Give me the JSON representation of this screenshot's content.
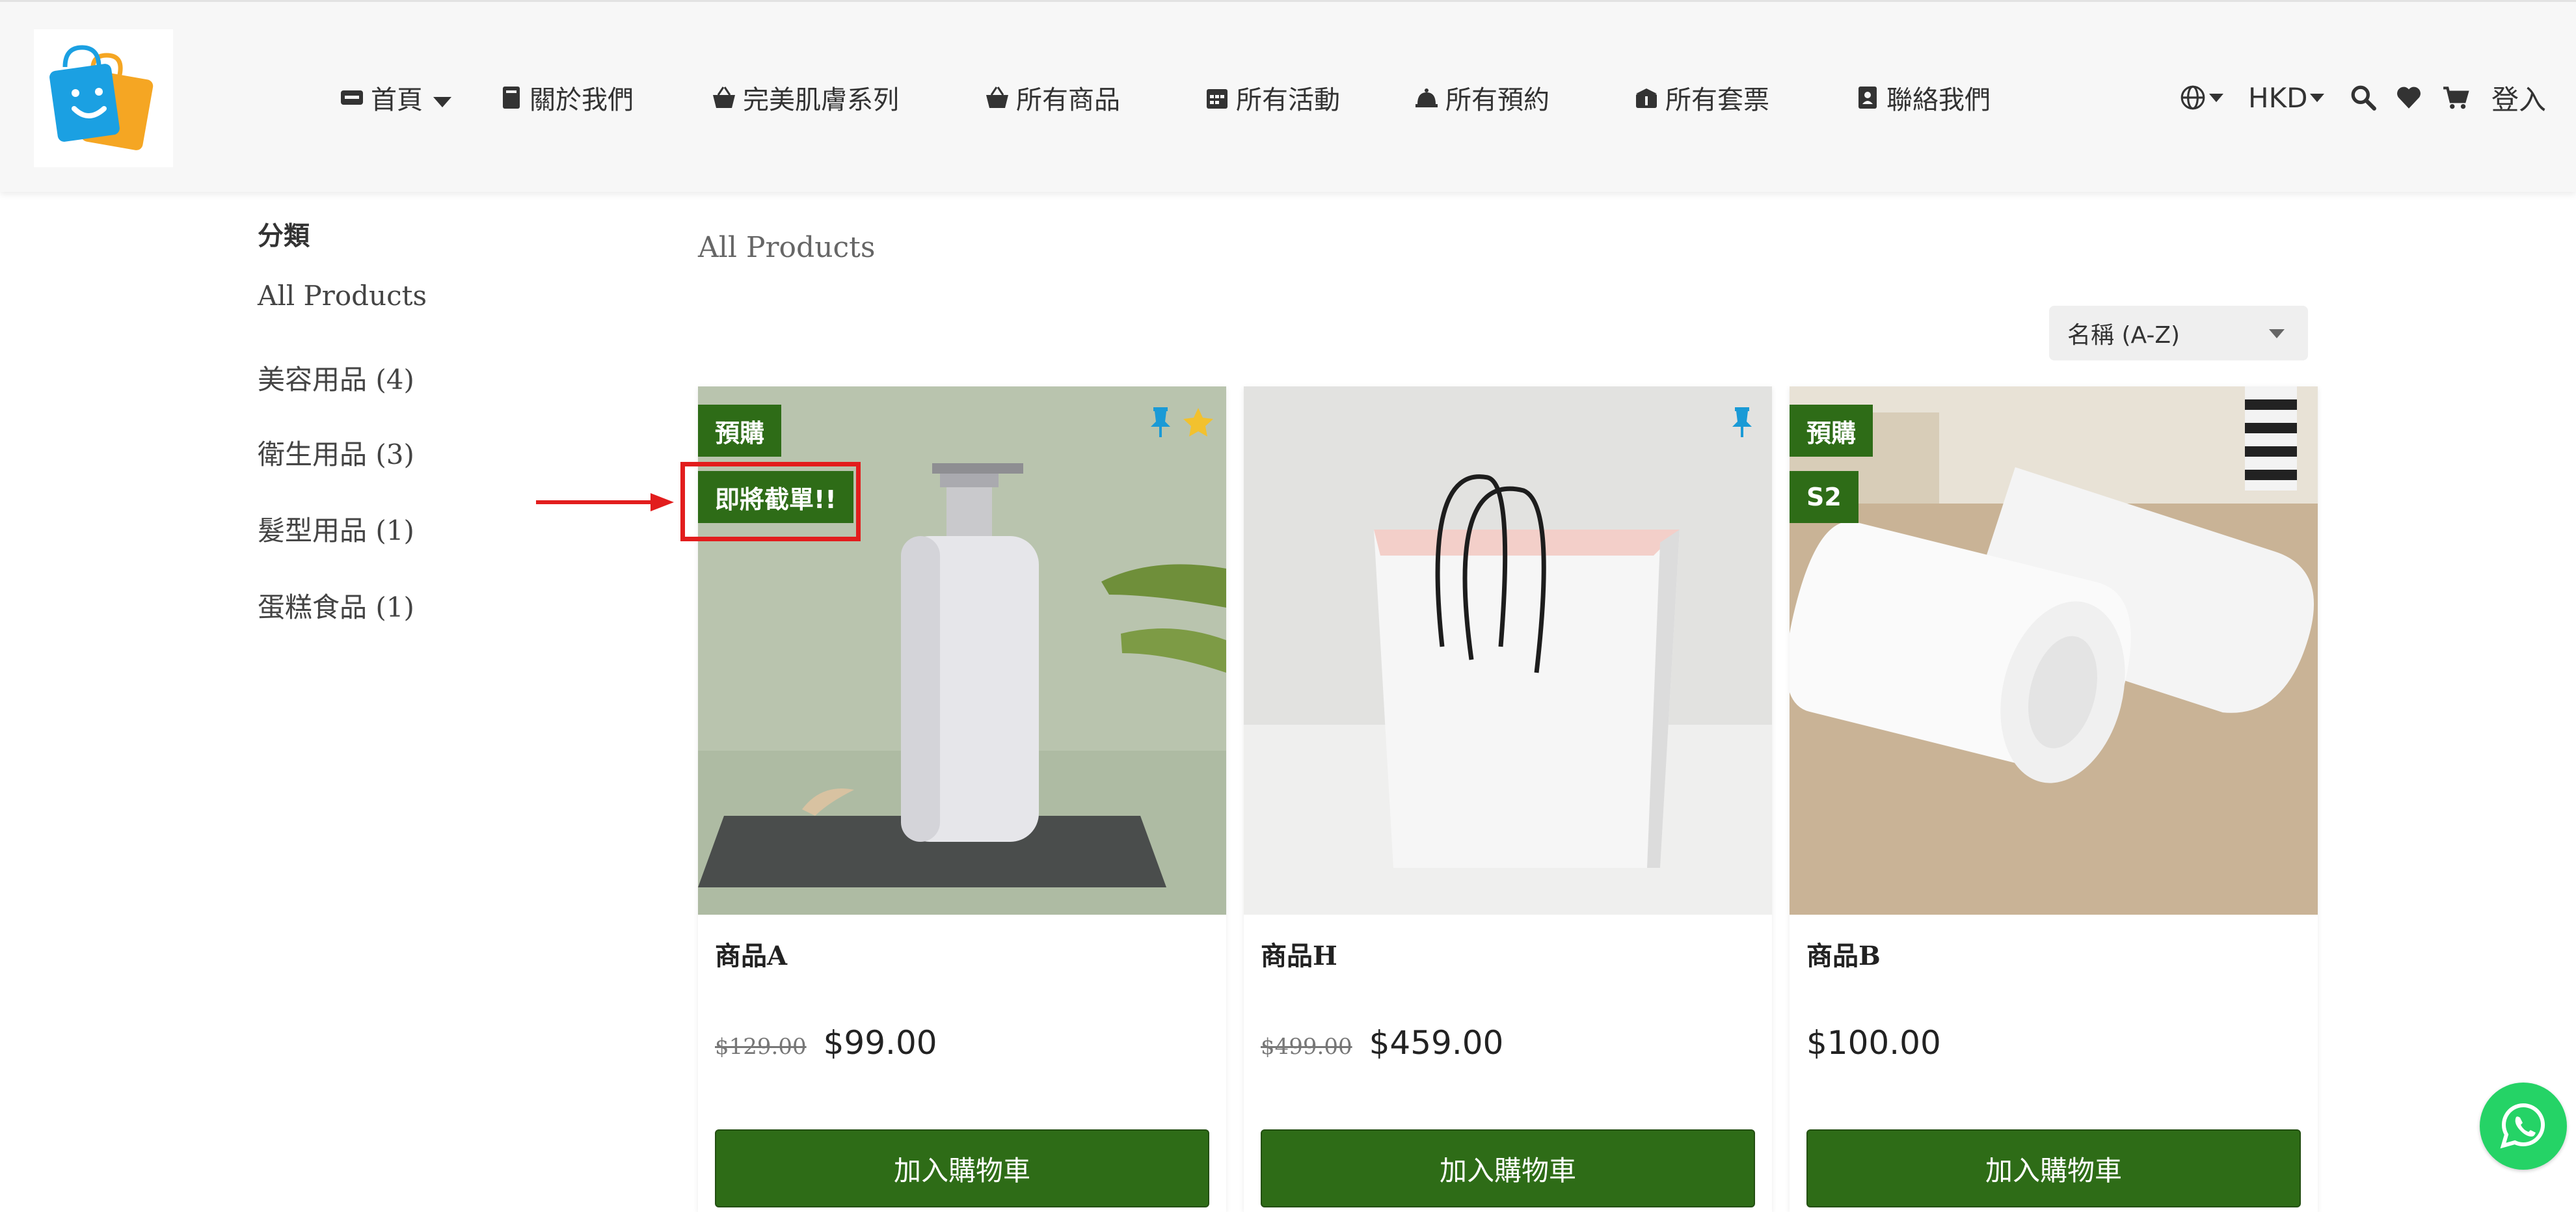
{
  "header": {
    "nav": [
      {
        "label": "首頁",
        "icon": "home-icon"
      },
      {
        "label": "關於我們",
        "icon": "book-icon"
      },
      {
        "label": "完美肌膚系列",
        "icon": "basket-icon"
      },
      {
        "label": "所有商品",
        "icon": "basket-icon"
      },
      {
        "label": "所有活動",
        "icon": "calendar-icon"
      },
      {
        "label": "所有預約",
        "icon": "bell-icon"
      },
      {
        "label": "所有套票",
        "icon": "ticket-icon"
      },
      {
        "label": "聯絡我們",
        "icon": "contact-book-icon"
      }
    ],
    "currency": "HKD",
    "login": "登入"
  },
  "sidebar": {
    "title": "分類",
    "items": [
      {
        "label": "All Products"
      },
      {
        "label": "美容用品 (4)"
      },
      {
        "label": "衛生用品 (3)"
      },
      {
        "label": "髮型用品 (1)"
      },
      {
        "label": "蛋糕食品 (1)"
      }
    ]
  },
  "main": {
    "breadcrumb": "All Products",
    "sort_value": "名稱 (A-Z)",
    "add_to_cart": "加入購物車",
    "products": [
      {
        "name": "商品A",
        "old_price": "$129.00",
        "price": "$99.00",
        "tags": [
          "預購",
          "即將截單!!"
        ],
        "pinned": true,
        "starred": true
      },
      {
        "name": "商品H",
        "old_price": "$499.00",
        "price": "$459.00",
        "tags": [],
        "pinned": true,
        "starred": false
      },
      {
        "name": "商品B",
        "old_price": "",
        "price": "$100.00",
        "tags": [
          "預購",
          "S2"
        ],
        "pinned": false,
        "starred": false
      }
    ]
  },
  "colors": {
    "accent_green": "#2e6c17",
    "whatsapp_green": "#25d366",
    "annotation_red": "#e21d1d"
  }
}
